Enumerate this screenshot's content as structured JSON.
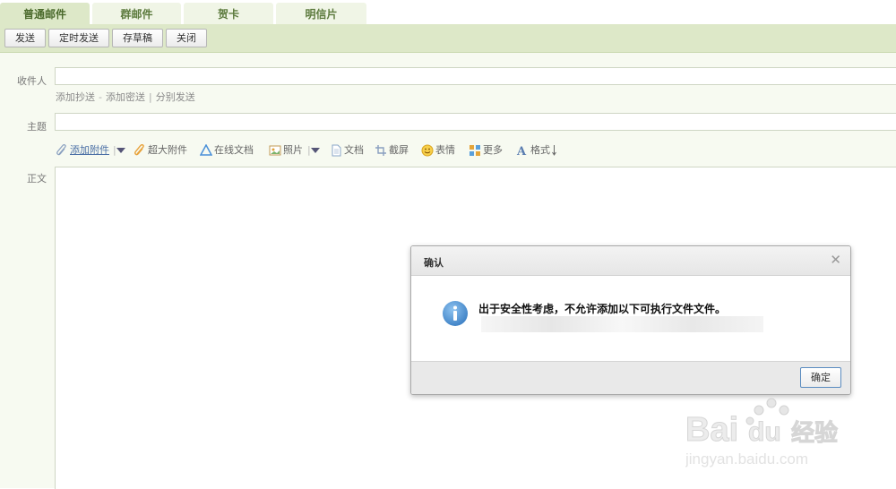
{
  "tabs": [
    {
      "label": "普通邮件",
      "active": true
    },
    {
      "label": "群邮件"
    },
    {
      "label": "贺卡"
    },
    {
      "label": "明信片"
    }
  ],
  "toolbar": {
    "send": "发送",
    "scheduled_send": "定时发送",
    "save_draft": "存草稿",
    "close": "关闭"
  },
  "form": {
    "to_label": "收件人",
    "to_value": "",
    "add_cc": "添加抄送",
    "add_bcc": "添加密送",
    "separate_send": "分别发送",
    "subject_label": "主题",
    "subject_value": "",
    "body_label": "正文"
  },
  "attachments_bar": {
    "add_attachment": "添加附件",
    "large_attachment": "超大附件",
    "online_doc": "在线文档",
    "photo": "照片",
    "document": "文档",
    "screenshot": "截屏",
    "emoji": "表情",
    "more": "更多",
    "format": "格式"
  },
  "dialog": {
    "title": "确认",
    "message": "出于安全性考虑，不允许添加以下可执行文件文件。",
    "ok": "确定",
    "icon": "info-icon"
  },
  "watermark": {
    "brand": "Bai du 经验",
    "url": "jingyan.baidu.com"
  },
  "colors": {
    "tab_bg": "#f0f5e6",
    "tab_active_bg": "#dde8c8",
    "toolbar_bg": "#dde8c8",
    "form_bg": "#f7faf1",
    "info_blue": "#4a90d9"
  }
}
